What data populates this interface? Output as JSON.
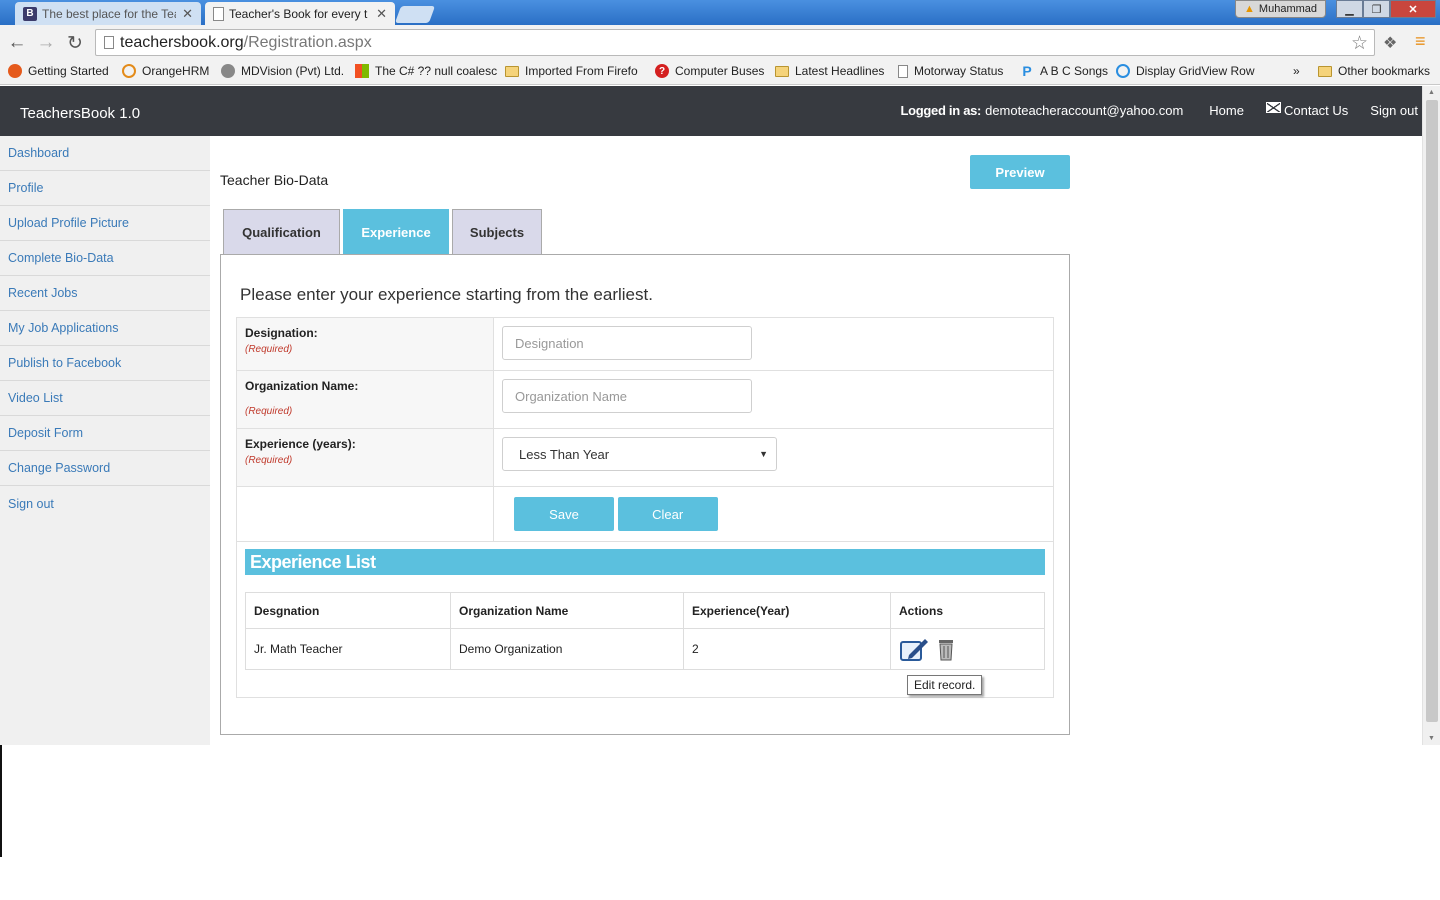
{
  "browser": {
    "tabs": [
      {
        "title": "The best place for the Tea",
        "active": false
      },
      {
        "title": "Teacher's Book for every t",
        "active": true
      }
    ],
    "user": "Muhammad",
    "url_host": "teachersbook.org",
    "url_path": "/Registration.aspx",
    "bookmarks": [
      "Getting Started",
      "OrangeHRM",
      "MDVision (Pvt) Ltd.",
      "The C# ?? null coalesc",
      "Imported From Firefo",
      "Computer Buses",
      "Latest Headlines",
      "Motorway Status",
      "A B C Songs",
      "Display GridView Row",
      "»",
      "Other bookmarks"
    ]
  },
  "app": {
    "brand": "TeachersBook 1.0",
    "logged_in_label": "Logged in as:",
    "email": "demoteacheraccount@yahoo.com",
    "nav": {
      "home": "Home",
      "contact": "Contact Us",
      "signout": "Sign out"
    }
  },
  "sidebar": {
    "items": [
      "Dashboard",
      "Profile",
      "Upload Profile Picture",
      "Complete Bio-Data",
      "Recent Jobs",
      "My Job Applications",
      "Publish to Facebook",
      "Video List",
      "Deposit Form",
      "Change Password",
      "Sign out"
    ]
  },
  "main": {
    "title": "Teacher Bio-Data",
    "preview": "Preview",
    "tabs": [
      {
        "label": "Qualification",
        "active": false
      },
      {
        "label": "Experience",
        "active": true
      },
      {
        "label": "Subjects",
        "active": false
      }
    ],
    "intro": "Please enter your experience starting from the earliest.",
    "required": "(Required)",
    "form": {
      "designation_label": "Designation:",
      "designation_placeholder": "Designation",
      "organization_label": "Organization Name:",
      "organization_placeholder": "Organization Name",
      "experience_label": "Experience (years):",
      "experience_value": "Less Than Year",
      "save": "Save",
      "clear": "Clear"
    },
    "list": {
      "title": "Experience List",
      "columns": [
        "Desgnation",
        "Organization Name",
        "Experience(Year)",
        "Actions"
      ],
      "rows": [
        {
          "designation": "Jr. Math Teacher",
          "organization": "Demo Organization",
          "years": "2"
        }
      ],
      "tooltip": "Edit record."
    }
  },
  "colors": {
    "accent": "#5bc0de",
    "navbar": "#373a40",
    "link": "#3a7ab8",
    "required": "#c0392b"
  }
}
